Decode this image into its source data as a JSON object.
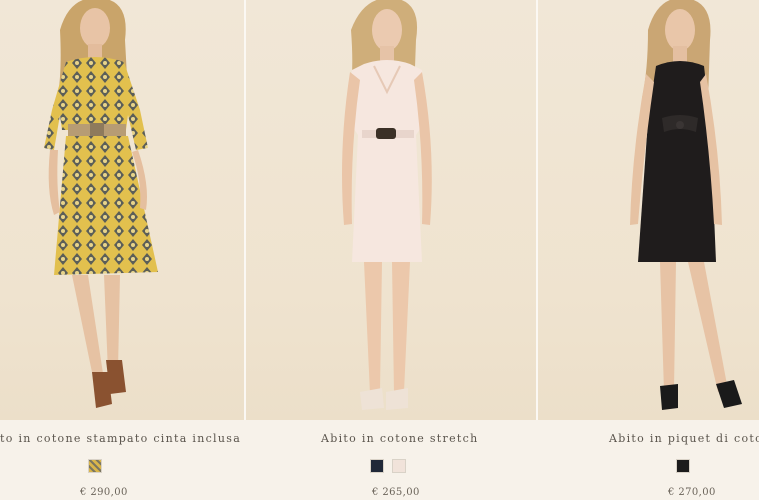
{
  "products": [
    {
      "name": "to in cotone stampato cinta inclusa",
      "price": "€ 290,00",
      "swatches": [
        {
          "color": "#d9b54a",
          "label": "yellow-print"
        }
      ]
    },
    {
      "name": "Abito in cotone stretch",
      "price": "€ 265,00",
      "swatches": [
        {
          "color": "#202838",
          "label": "navy"
        },
        {
          "color": "#f1e3da",
          "label": "powder"
        }
      ]
    },
    {
      "name": "Abito in piquet di cotone",
      "price": "€ 270,00",
      "swatches": [
        {
          "color": "#1c1c1c",
          "label": "black"
        }
      ]
    }
  ],
  "colors": {
    "background": "#f7f2ea",
    "photo_backdrop": "#efe3cf",
    "text": "#5a544c"
  }
}
